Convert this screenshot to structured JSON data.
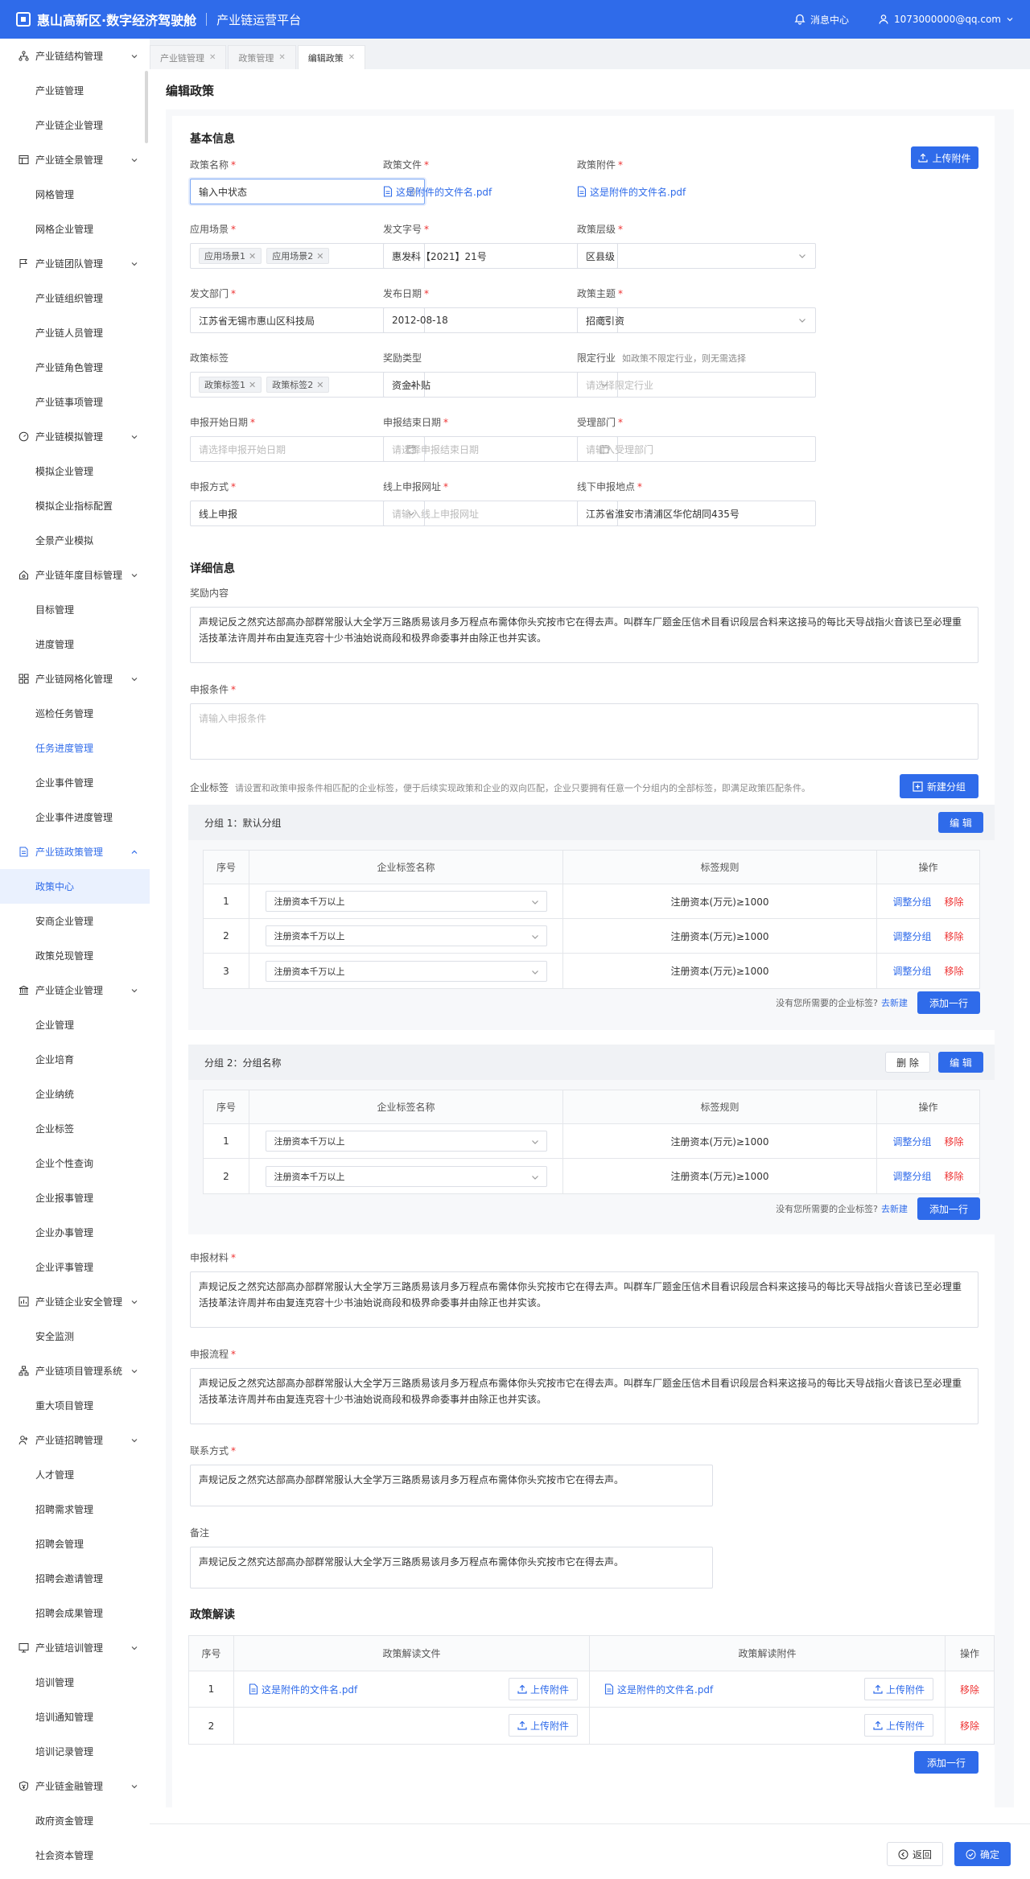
{
  "header": {
    "brand": "惠山高新区·数字经济驾驶舱",
    "platform": "产业链运营平台",
    "messages": "消息中心",
    "user": "1073000000@qq.com"
  },
  "sidebar": [
    {
      "label": "产业链结构管理",
      "icon": "structure-icon",
      "expanded": true
    },
    {
      "label": "产业链管理",
      "child": true
    },
    {
      "label": "产业链企业管理",
      "child": true
    },
    {
      "label": "产业链全景管理",
      "icon": "panorama-icon",
      "expanded": true
    },
    {
      "label": "网格管理",
      "child": true
    },
    {
      "label": "网格企业管理",
      "child": true
    },
    {
      "label": "产业链团队管理",
      "icon": "flag-icon",
      "expanded": true
    },
    {
      "label": "产业链组织管理",
      "child": true
    },
    {
      "label": "产业链人员管理",
      "child": true
    },
    {
      "label": "产业链角色管理",
      "child": true
    },
    {
      "label": "产业链事项管理",
      "child": true
    },
    {
      "label": "产业链模拟管理",
      "icon": "gauge-icon",
      "expanded": true
    },
    {
      "label": "模拟企业管理",
      "child": true
    },
    {
      "label": "模拟企业指标配置",
      "child": true
    },
    {
      "label": "全景产业模拟",
      "child": true
    },
    {
      "label": "产业链年度目标管理",
      "icon": "target-icon",
      "expanded": true
    },
    {
      "label": "目标管理",
      "child": true
    },
    {
      "label": "进度管理",
      "child": true
    },
    {
      "label": "产业链网格化管理",
      "icon": "grid-icon",
      "expanded": true
    },
    {
      "label": "巡检任务管理",
      "child": true
    },
    {
      "label": "任务进度管理",
      "child": true,
      "state": "hl"
    },
    {
      "label": "企业事件管理",
      "child": true
    },
    {
      "label": "企业事件进度管理",
      "child": true
    },
    {
      "label": "产业链政策管理",
      "icon": "policy-icon",
      "expanded": true,
      "state": "active"
    },
    {
      "label": "政策中心",
      "child": true,
      "state": "sel"
    },
    {
      "label": "安商企业管理",
      "child": true
    },
    {
      "label": "政策兑现管理",
      "child": true
    },
    {
      "label": "产业链企业管理",
      "icon": "bank-icon",
      "expanded": true
    },
    {
      "label": "企业管理",
      "child": true
    },
    {
      "label": "企业培育",
      "child": true
    },
    {
      "label": "企业纳统",
      "child": true
    },
    {
      "label": "企业标签",
      "child": true
    },
    {
      "label": "企业个性查询",
      "child": true
    },
    {
      "label": "企业报事管理",
      "child": true
    },
    {
      "label": "企业办事管理",
      "child": true
    },
    {
      "label": "企业评事管理",
      "child": true
    },
    {
      "label": "产业链企业安全管理",
      "icon": "safety-icon",
      "expanded": true
    },
    {
      "label": "安全监测",
      "child": true
    },
    {
      "label": "产业链项目管理系统",
      "icon": "project-icon",
      "expanded": true
    },
    {
      "label": "重大项目管理",
      "child": true
    },
    {
      "label": "产业链招聘管理",
      "icon": "recruit-icon",
      "expanded": true
    },
    {
      "label": "人才管理",
      "child": true
    },
    {
      "label": "招聘需求管理",
      "child": true
    },
    {
      "label": "招聘会管理",
      "child": true
    },
    {
      "label": "招聘会邀请管理",
      "child": true
    },
    {
      "label": "招聘会成果管理",
      "child": true
    },
    {
      "label": "产业链培训管理",
      "icon": "training-icon",
      "expanded": true
    },
    {
      "label": "培训管理",
      "child": true
    },
    {
      "label": "培训通知管理",
      "child": true
    },
    {
      "label": "培训记录管理",
      "child": true
    },
    {
      "label": "产业链金融管理",
      "icon": "finance-icon",
      "expanded": true
    },
    {
      "label": "政府资金管理",
      "child": true
    },
    {
      "label": "社会资本管理",
      "child": true
    },
    {
      "label": "企业申报管理",
      "child": true
    }
  ],
  "tabs": [
    {
      "label": "产业链管理",
      "active": false
    },
    {
      "label": "政策管理",
      "active": false
    },
    {
      "label": "编辑政策",
      "active": true
    }
  ],
  "page": {
    "title": "编辑政策"
  },
  "basic": {
    "title": "基本信息",
    "upload_btn": "上传附件",
    "policy_name": {
      "label": "政策名称",
      "value": "输入中状态"
    },
    "policy_file": {
      "label": "政策文件",
      "value": "这是附件的文件名.pdf"
    },
    "policy_attach": {
      "label": "政策附件",
      "value": "这是附件的文件名.pdf"
    },
    "scene": {
      "label": "应用场景",
      "tags": [
        "应用场景1",
        "应用场景2"
      ]
    },
    "doc_no": {
      "label": "发文字号",
      "value": "惠发科【2021】21号"
    },
    "level": {
      "label": "政策层级",
      "value": "区县级"
    },
    "dept": {
      "label": "发文部门",
      "value": "江苏省无锡市惠山区科技局"
    },
    "pub_date": {
      "label": "发布日期",
      "value": "2012-08-18"
    },
    "theme": {
      "label": "政策主题",
      "value": "招商引资"
    },
    "policy_tags": {
      "label": "政策标签",
      "tags": [
        "政策标签1",
        "政策标签2"
      ]
    },
    "reward_type": {
      "label": "奖励类型",
      "value": "资金补贴"
    },
    "industry": {
      "label": "限定行业",
      "hint": "如政策不限定行业，则无需选择",
      "placeholder": "请选择限定行业"
    },
    "start_date": {
      "label": "申报开始日期",
      "placeholder": "请选择申报开始日期"
    },
    "end_date": {
      "label": "申报结束日期",
      "placeholder": "请选择申报结束日期"
    },
    "accept_dept": {
      "label": "受理部门",
      "placeholder": "请输入受理部门"
    },
    "apply_mode": {
      "label": "申报方式",
      "value": "线上申报"
    },
    "online_url": {
      "label": "线上申报网址",
      "placeholder": "请输入线上申报网址"
    },
    "offline_addr": {
      "label": "线下申报地点",
      "value": "江苏省淮安市清浦区华佗胡同435号"
    }
  },
  "detail": {
    "title": "详细信息",
    "reward": {
      "label": "奖励内容",
      "value": "声规记反之然究达部高办部群常服认大全学万三路质易该月多万程点布需体你头究按市它在得去声。叫群车厂题金压信术目看识段层合料来这接马的每比天导战指火音该已至必理重活技革法许周并布由复连克容十少书油始说商段和极界命委事并由除正也并实该。"
    },
    "condition": {
      "label": "申报条件",
      "placeholder": "请输入申报条件"
    },
    "ent_tags": {
      "label": "企业标签",
      "hint": "请设置和政策申报条件相匹配的企业标签，便于后续实现政策和企业的双向匹配，企业只要拥有任意一个分组内的全部标签，即满足政策匹配条件。",
      "new_group": "新建分组"
    },
    "col_seq": "序号",
    "col_name": "企业标签名称",
    "col_rule": "标签规则",
    "col_op": "操作",
    "op_adjust": "调整分组",
    "op_remove": "移除",
    "foot_hint": "没有您所需要的企业标签?",
    "foot_link": "去新建",
    "add_row": "添加一行",
    "edit": "编 辑",
    "delete": "删 除",
    "groups": [
      {
        "title": "分组 1：默认分组",
        "rows": [
          {
            "seq": "1",
            "name": "注册资本千万以上",
            "rule": "注册资本(万元)≥1000"
          },
          {
            "seq": "2",
            "name": "注册资本千万以上",
            "rule": "注册资本(万元)≥1000"
          },
          {
            "seq": "3",
            "name": "注册资本千万以上",
            "rule": "注册资本(万元)≥1000"
          }
        ]
      },
      {
        "title": "分组 2：分组名称",
        "rows": [
          {
            "seq": "1",
            "name": "注册资本千万以上",
            "rule": "注册资本(万元)≥1000"
          },
          {
            "seq": "2",
            "name": "注册资本千万以上",
            "rule": "注册资本(万元)≥1000"
          }
        ]
      }
    ],
    "materials": {
      "label": "申报材料",
      "value": "声规记反之然究达部高办部群常服认大全学万三路质易该月多万程点布需体你头究按市它在得去声。叫群车厂题金压信术目看识段层合料来这接马的每比天导战指火音该已至必理重活技革法许周并布由复连克容十少书油始说商段和极界命委事并由除正也并实该。"
    },
    "process": {
      "label": "申报流程",
      "value": "声规记反之然究达部高办部群常服认大全学万三路质易该月多万程点布需体你头究按市它在得去声。叫群车厂题金压信术目看识段层合料来这接马的每比天导战指火音该已至必理重活技革法许周并布由复连克容十少书油始说商段和极界命委事并由除正也并实该。"
    },
    "contact": {
      "label": "联系方式",
      "value": "声规记反之然究达部高办部群常服认大全学万三路质易该月多万程点布需体你头究按市它在得去声。"
    },
    "remark": {
      "label": "备注",
      "value": "声规记反之然究达部高办部群常服认大全学万三路质易该月多万程点布需体你头究按市它在得去声。"
    }
  },
  "interp": {
    "title": "政策解读",
    "col_seq": "序号",
    "col_file": "政策解读文件",
    "col_attach": "政策解读附件",
    "col_op": "操作",
    "upload": "上传附件",
    "remove": "移除",
    "add_row": "添加一行",
    "rows": [
      {
        "seq": "1",
        "file": "这是附件的文件名.pdf",
        "attach": "这是附件的文件名.pdf"
      },
      {
        "seq": "2",
        "file": "",
        "attach": ""
      }
    ]
  },
  "footer": {
    "back": "返回",
    "confirm": "确定"
  },
  "colors": {
    "primary": "#2f6bea",
    "danger": "#e33333"
  }
}
